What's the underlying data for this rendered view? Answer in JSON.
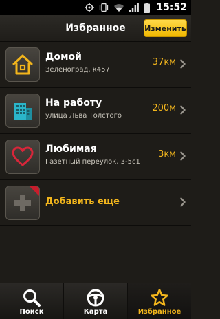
{
  "status_bar": {
    "time": "15:52"
  },
  "header": {
    "title": "Избранное",
    "edit_label": "Изменить"
  },
  "favorites": [
    {
      "icon": "house-icon",
      "title": "Домой",
      "address": "Зеленоград, к457",
      "distance": "37км"
    },
    {
      "icon": "office-building-icon",
      "title": "На работу",
      "address": "улица Льва Толстого",
      "distance": "200м"
    },
    {
      "icon": "heart-icon",
      "title": "Любимая",
      "address": "Газетный переулок, 3-5с1",
      "distance": "3км"
    }
  ],
  "add_more": {
    "icon": "plus-icon",
    "label": "Добавить еще"
  },
  "tabs": [
    {
      "icon": "search-icon",
      "label": "Поиск",
      "active": false
    },
    {
      "icon": "map-steering-icon",
      "label": "Карта",
      "active": false
    },
    {
      "icon": "star-icon",
      "label": "Избранное",
      "active": true
    }
  ],
  "colors": {
    "accent": "#f2b51c",
    "background": "#1e1c18",
    "button": "#f5c518"
  }
}
